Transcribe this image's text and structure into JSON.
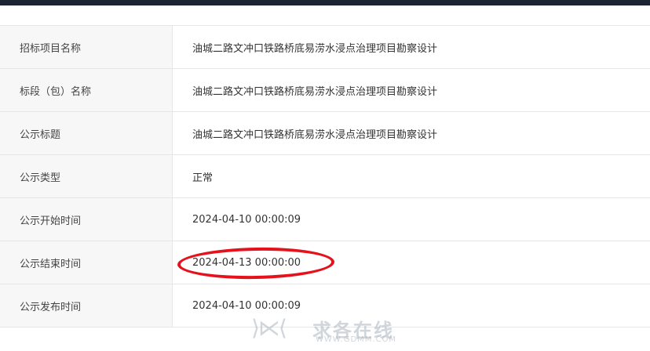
{
  "rows": [
    {
      "label": "招标项目名称",
      "value": "油城二路文冲口铁路桥底易涝水浸点治理项目勘察设计"
    },
    {
      "label": "标段（包）名称",
      "value": "油城二路文冲口铁路桥底易涝水浸点治理项目勘察设计"
    },
    {
      "label": "公示标题",
      "value": "油城二路文冲口铁路桥底易涝水浸点治理项目勘察设计"
    },
    {
      "label": "公示类型",
      "value": "正常"
    },
    {
      "label": "公示开始时间",
      "value": "2024-04-10 00:00:09"
    },
    {
      "label": "公示结束时间",
      "value": "2024-04-13 00:00:00"
    },
    {
      "label": "公示发布时间",
      "value": "2024-04-10 00:00:09"
    }
  ],
  "watermark": {
    "logo": "⟩⋉⟨",
    "text": "求各在线",
    "url": "WWW.GDMM.COM"
  },
  "colors": {
    "highlight": "#e5121b",
    "topbar": "#1b2430",
    "label_bg": "#f7f7f7"
  }
}
